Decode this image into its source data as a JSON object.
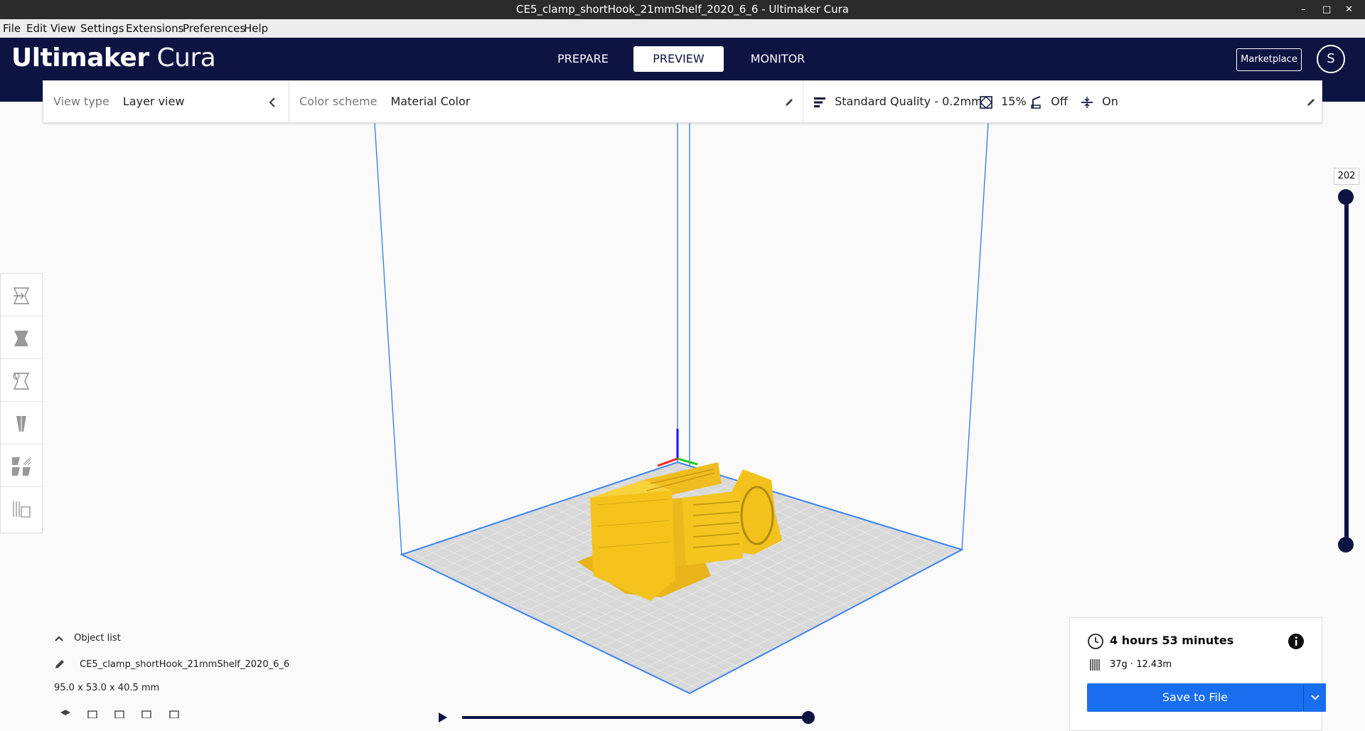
{
  "window": {
    "title": "CE5_clamp_shortHook_21mmShelf_2020_6_6 - Ultimaker Cura",
    "minimize": "–",
    "maximize": "□",
    "close": "✕"
  },
  "menu": [
    "File",
    "Edit",
    "View",
    "Settings",
    "Extensions",
    "Preferences",
    "Help"
  ],
  "header": {
    "brand": "Ultimaker",
    "product": "Cura",
    "tabs": [
      "PREPARE",
      "PREVIEW",
      "MONITOR"
    ],
    "active_tab": "PREVIEW",
    "marketplace": "Marketplace",
    "avatar_initial": "S"
  },
  "view_panel": {
    "view_type_label": "View type",
    "view_type_value": "Layer view",
    "color_scheme_label": "Color scheme",
    "color_scheme_value": "Material Color",
    "quality": "Standard Quality - 0.2mm",
    "infill": "15%",
    "support": "Off",
    "adhesion": "On"
  },
  "layer_slider": {
    "current_layer": "202",
    "upper_value": 1.0,
    "lower_value": 0.0
  },
  "object_list": {
    "toggle_label": "Object list",
    "object_name": "CE5_clamp_shortHook_21mmShelf_2020_6_6",
    "dimensions": "95.0 x 53.0 x 40.5 mm"
  },
  "print_info": {
    "time": "4 hours 53 minutes",
    "material": "37g · 12.43m",
    "save_label": "Save to File"
  },
  "colors": {
    "header_bg": "#0d1442",
    "accent_blue": "#196ef0",
    "material_yellow": "#f4c21b",
    "build_volume_lines": "#3b82f0"
  }
}
